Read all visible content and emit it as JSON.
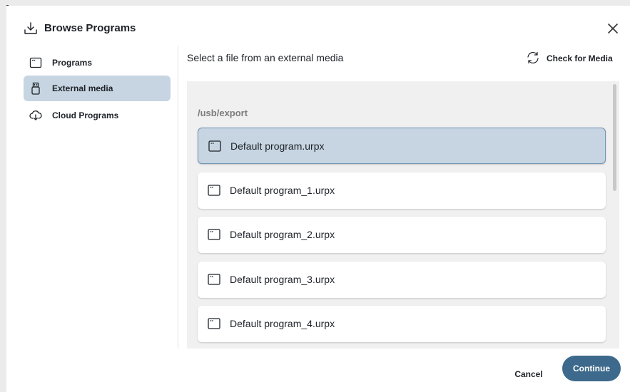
{
  "dialog": {
    "title": "Browse Programs",
    "title_icon": "download-icon",
    "close_icon": "close-icon"
  },
  "sidebar": {
    "items": [
      {
        "label": "Programs",
        "icon": "program-window-icon",
        "active": false
      },
      {
        "label": "External media",
        "icon": "usb-drive-icon",
        "active": true
      },
      {
        "label": "Cloud Programs",
        "icon": "cloud-download-icon",
        "active": false
      }
    ]
  },
  "main": {
    "subtitle": "Select a file from an external media",
    "check_media_label": "Check for Media",
    "check_media_icon": "refresh-icon",
    "path": "/usb/export",
    "files": [
      {
        "name": "Default program.urpx",
        "selected": true
      },
      {
        "name": "Default program_1.urpx",
        "selected": false
      },
      {
        "name": "Default program_2.urpx",
        "selected": false
      },
      {
        "name": "Default program_3.urpx",
        "selected": false
      },
      {
        "name": "Default program_4.urpx",
        "selected": false
      }
    ]
  },
  "footer": {
    "cancel_label": "Cancel",
    "continue_label": "Continue"
  },
  "colors": {
    "accent": "#3d6a8c",
    "selected_bg": "#c6d5e1",
    "panel_bg": "#f0f0f0"
  }
}
